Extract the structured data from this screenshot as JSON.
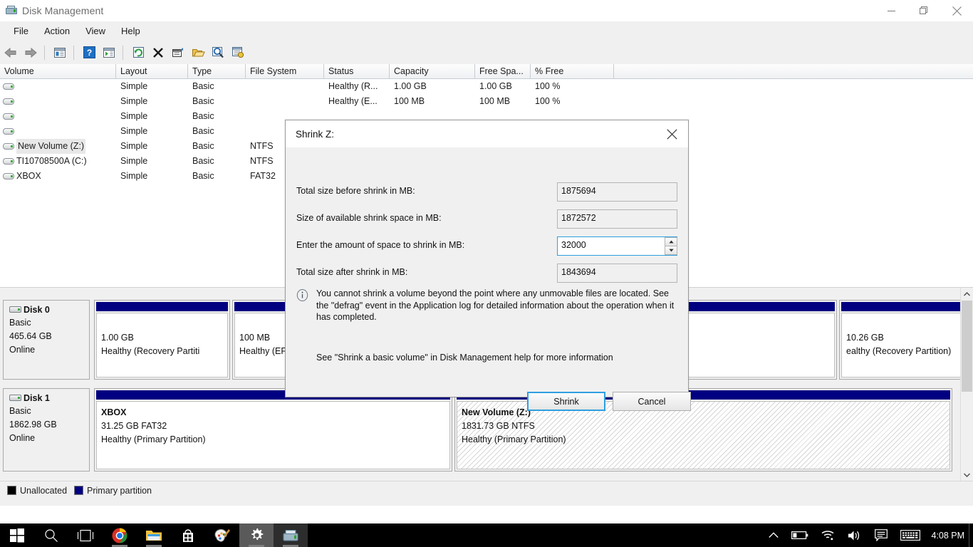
{
  "window": {
    "title": "Disk Management",
    "icon": "disk-management-icon",
    "controls": {
      "minimize": "minimize-icon",
      "maximize": "restore-icon",
      "close": "close-icon"
    }
  },
  "menubar": {
    "items": [
      "File",
      "Action",
      "View",
      "Help"
    ]
  },
  "toolbar": {
    "buttons": [
      "back-arrow-icon",
      "forward-arrow-icon",
      "separator",
      "show-hide-console-tree-icon",
      "separator",
      "help-icon",
      "show-hide-action-pane-icon",
      "separator",
      "refresh-icon",
      "delete-icon",
      "properties-icon",
      "open-icon",
      "rescan-disks-icon",
      "view-options-icon"
    ]
  },
  "volume_list": {
    "columns": [
      "Volume",
      "Layout",
      "Type",
      "File System",
      "Status",
      "Capacity",
      "Free Spa...",
      "% Free"
    ],
    "rows": [
      {
        "volume": "",
        "layout": "Simple",
        "type": "Basic",
        "fs": "",
        "status": "Healthy (R...",
        "capacity": "1.00 GB",
        "free": "1.00 GB",
        "pct": "100 %",
        "selected": false
      },
      {
        "volume": "",
        "layout": "Simple",
        "type": "Basic",
        "fs": "",
        "status": "Healthy (E...",
        "capacity": "100 MB",
        "free": "100 MB",
        "pct": "100 %",
        "selected": false
      },
      {
        "volume": "",
        "layout": "Simple",
        "type": "Basic",
        "fs": "",
        "status": "",
        "capacity": "",
        "free": "",
        "pct": "",
        "selected": false
      },
      {
        "volume": "",
        "layout": "Simple",
        "type": "Basic",
        "fs": "",
        "status": "",
        "capacity": "",
        "free": "",
        "pct": "",
        "selected": false
      },
      {
        "volume": "New Volume (Z:)",
        "layout": "Simple",
        "type": "Basic",
        "fs": "NTFS",
        "status": "",
        "capacity": "",
        "free": "",
        "pct": "",
        "selected": true
      },
      {
        "volume": "TI10708500A (C:)",
        "layout": "Simple",
        "type": "Basic",
        "fs": "NTFS",
        "status": "",
        "capacity": "",
        "free": "",
        "pct": "",
        "selected": false
      },
      {
        "volume": "XBOX",
        "layout": "Simple",
        "type": "Basic",
        "fs": "FAT32",
        "status": "",
        "capacity": "",
        "free": "",
        "pct": "",
        "selected": false
      }
    ]
  },
  "graph_view": {
    "disks": [
      {
        "name": "Disk 0",
        "kind": "Basic",
        "size": "465.64 GB",
        "state": "Online",
        "partitions": [
          {
            "label": "",
            "size": "1.00 GB",
            "status": "Healthy (Recovery Partiti",
            "hatched": false
          },
          {
            "label": "",
            "size": "100 MB",
            "status": "Healthy (EF",
            "hatched": false
          },
          {
            "label": "",
            "size": "10.26 GB",
            "status": "ealthy (Recovery Partition)",
            "hatched": false
          }
        ]
      },
      {
        "name": "Disk 1",
        "kind": "Basic",
        "size": "1862.98 GB",
        "state": "Online",
        "partitions": [
          {
            "label": "XBOX",
            "size": "31.25 GB FAT32",
            "status": "Healthy (Primary Partition)",
            "hatched": false
          },
          {
            "label": "New Volume  (Z:)",
            "size": "1831.73 GB NTFS",
            "status": "Healthy (Primary Partition)",
            "hatched": true
          }
        ]
      }
    ],
    "scrollbar": {
      "up": "chevron-up-icon",
      "down": "chevron-down-icon"
    }
  },
  "legend": {
    "items": [
      {
        "label": "Unallocated",
        "color": "#000000"
      },
      {
        "label": "Primary partition",
        "color": "#000080"
      }
    ]
  },
  "dialog": {
    "title": "Shrink Z:",
    "close_icon": "close-icon",
    "fields": [
      {
        "label": "Total size before shrink in MB:",
        "value": "1875694",
        "editable": false
      },
      {
        "label": "Size of available shrink space in MB:",
        "value": "1872572",
        "editable": false
      },
      {
        "label": "Enter the amount of space to shrink in MB:",
        "value": "32000",
        "editable": true
      },
      {
        "label": "Total size after shrink in MB:",
        "value": "1843694",
        "editable": false
      }
    ],
    "info_icon": "info-icon",
    "info_text": "You cannot shrink a volume beyond the point where any unmovable files are located. See the \"defrag\" event in the Application log for detailed information about the operation when it has completed.",
    "help_text": "See \"Shrink a basic volume\" in Disk Management help for more information",
    "buttons": {
      "primary": "Shrink",
      "secondary": "Cancel"
    },
    "accent_color": "#2e9fe0"
  },
  "taskbar": {
    "start": "windows-start-icon",
    "apps": [
      "search-icon",
      "task-view-icon",
      "chrome-icon",
      "file-explorer-icon",
      "microsoft-store-icon",
      "paint-icon",
      "settings-icon",
      "disk-management-icon"
    ],
    "tray": [
      "show-hidden-icons-chevron-icon",
      "battery-icon",
      "wifi-icon",
      "volume-icon",
      "action-center-icon",
      "touch-keyboard-icon"
    ],
    "clock": "4:08 PM"
  }
}
